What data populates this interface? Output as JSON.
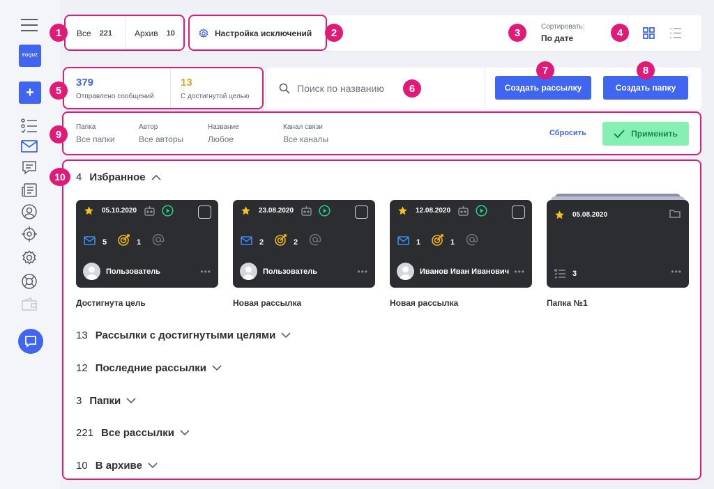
{
  "sidebar": {
    "logo_text": "FOQUZ",
    "plus_label": "+"
  },
  "tabs": [
    {
      "label": "Все",
      "count": "221"
    },
    {
      "label": "Архив",
      "count": "10"
    }
  ],
  "exceptions_label": "Настройка исключений",
  "sort": {
    "caption": "Сортировать:",
    "value": "По дате"
  },
  "stats": {
    "sent": {
      "value": "379",
      "label": "Отправлено сообщений",
      "color": "#3f65f1"
    },
    "goal": {
      "value": "13",
      "label": "С достигнутой целью",
      "color": "#d9a524"
    }
  },
  "search": {
    "placeholder": "Поиск по названию"
  },
  "buttons": {
    "create_mailing": "Создать рассылку",
    "create_folder": "Создать папку"
  },
  "filters": [
    {
      "caption": "Папка",
      "value": "Все папки"
    },
    {
      "caption": "Автор",
      "value": "Все авторы"
    },
    {
      "caption": "Название",
      "value": "Любое"
    },
    {
      "caption": "Канал связи",
      "value": "Все каналы"
    }
  ],
  "filter_actions": {
    "reset": "Сбросить",
    "apply": "Применить"
  },
  "favorites": {
    "count": "4",
    "title": "Избранное",
    "cards": [
      {
        "date": "05.10.2020",
        "mail": "5",
        "goal": "1",
        "user": "Пользователь",
        "title": "Достигнута цель"
      },
      {
        "date": "23.08.2020",
        "mail": "2",
        "goal": "2",
        "user": "Пользователь",
        "title": "Новая рассылка"
      },
      {
        "date": "12.08.2020",
        "mail": "1",
        "goal": "1",
        "user": "Иванов Иван Иванович",
        "title": "Новая рассылка"
      },
      {
        "date": "05.08.2020",
        "items": "3",
        "title": "Папка №1"
      }
    ]
  },
  "groups": [
    {
      "count": "13",
      "title": "Рассылки с достигнутыми целями"
    },
    {
      "count": "12",
      "title": "Последние рассылки"
    },
    {
      "count": "3",
      "title": "Папки"
    },
    {
      "count": "221",
      "title": "Все рассылки"
    },
    {
      "count": "10",
      "title": "В архиве"
    }
  ],
  "markers": [
    "1",
    "2",
    "3",
    "4",
    "5",
    "6",
    "7",
    "8",
    "9",
    "10"
  ],
  "colors": {
    "accent": "#3f65f1",
    "callout": "#e11a77",
    "apply": "#86f0b2",
    "card": "#2b2d30"
  }
}
